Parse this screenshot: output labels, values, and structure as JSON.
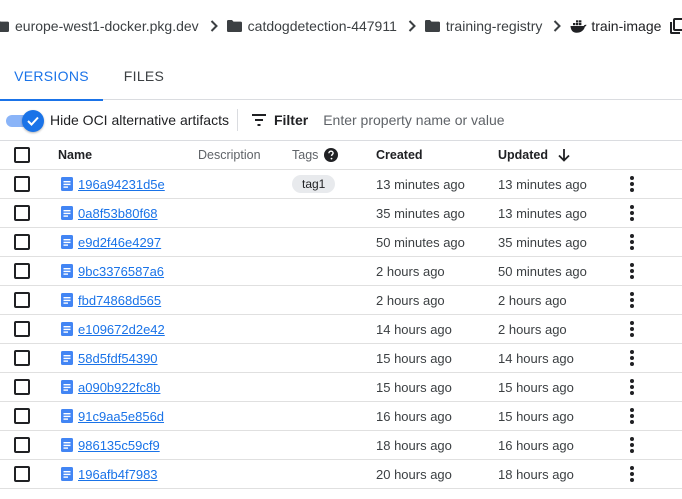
{
  "breadcrumb": {
    "items": [
      {
        "label": "europe-west1-docker.pkg.dev"
      },
      {
        "label": "catdogdetection-447911"
      },
      {
        "label": "training-registry"
      }
    ],
    "current": "train-image"
  },
  "tabs": [
    {
      "label": "VERSIONS",
      "active": true
    },
    {
      "label": "FILES",
      "active": false
    }
  ],
  "filterbar": {
    "toggle_label": "Hide OCI alternative artifacts",
    "toggle_on": true,
    "filter_label": "Filter",
    "filter_placeholder": "Enter property name or value"
  },
  "table": {
    "columns": {
      "name": "Name",
      "description": "Description",
      "tags": "Tags",
      "created": "Created",
      "updated": "Updated"
    },
    "rows": [
      {
        "name": "196a94231d5e",
        "tag": "tag1",
        "created": "13 minutes ago",
        "updated": "13 minutes ago"
      },
      {
        "name": "0a8f53b80f68",
        "tag": "",
        "created": "35 minutes ago",
        "updated": "13 minutes ago"
      },
      {
        "name": "e9d2f46e4297",
        "tag": "",
        "created": "50 minutes ago",
        "updated": "35 minutes ago"
      },
      {
        "name": "9bc3376587a6",
        "tag": "",
        "created": "2 hours ago",
        "updated": "50 minutes ago"
      },
      {
        "name": "fbd74868d565",
        "tag": "",
        "created": "2 hours ago",
        "updated": "2 hours ago"
      },
      {
        "name": "e109672d2e42",
        "tag": "",
        "created": "14 hours ago",
        "updated": "2 hours ago"
      },
      {
        "name": "58d5fdf54390",
        "tag": "",
        "created": "15 hours ago",
        "updated": "14 hours ago"
      },
      {
        "name": "a090b922fc8b",
        "tag": "",
        "created": "15 hours ago",
        "updated": "15 hours ago"
      },
      {
        "name": "91c9aa5e856d",
        "tag": "",
        "created": "16 hours ago",
        "updated": "15 hours ago"
      },
      {
        "name": "986135c59cf9",
        "tag": "",
        "created": "18 hours ago",
        "updated": "16 hours ago"
      },
      {
        "name": "196afb4f7983",
        "tag": "",
        "created": "20 hours ago",
        "updated": "18 hours ago"
      }
    ]
  },
  "colors": {
    "accent": "#1a73e8",
    "toggle_track": "#8ab4f8",
    "divider": "#dadce0"
  },
  "icons": [
    "folder-icon",
    "chevron-right-icon",
    "docker-icon",
    "copy-icon",
    "check-icon",
    "filter-icon",
    "help-icon",
    "arrow-down-icon",
    "document-icon",
    "more-vert-icon"
  ]
}
